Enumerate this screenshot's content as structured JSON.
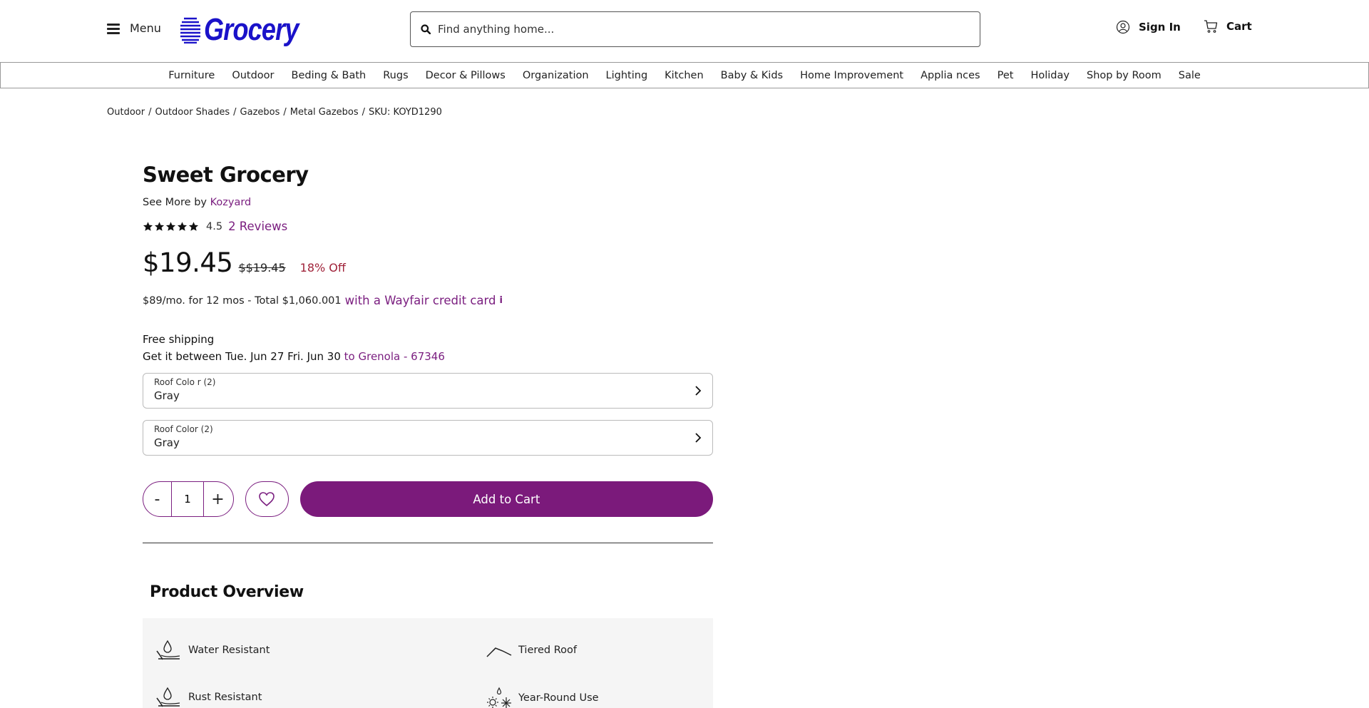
{
  "header": {
    "menu_label": "Menu",
    "logo_text": "Grocery",
    "search_placeholder": "Find anything home...",
    "signin_label": "Sign In",
    "cart_label": "Cart"
  },
  "nav": {
    "items": [
      "Furniture",
      "Outdoor",
      "Beding & Bath",
      "Rugs",
      "Decor & Pillows",
      "Organization",
      "Lighting",
      "Kitchen",
      "Baby & Kids",
      "Home Improvement",
      "Applia nces",
      "Pet",
      "Holiday",
      "Shop by Room",
      "Sale"
    ]
  },
  "breadcrumb": {
    "items": [
      "Outdoor",
      "Outdoor Shades",
      "Gazebos",
      "Metal Gazebos"
    ],
    "separator": "/",
    "sku": "SKU: KOYD1290"
  },
  "product": {
    "title": "Sweet Grocery",
    "see_more_prefix": "See More by",
    "brand": "Kozyard",
    "rating_value": "4.5",
    "rating_stars": 5,
    "reviews_label": "2 Reviews",
    "price": "$19.45",
    "old_price": "$$19.45",
    "discount": "18% Off",
    "finance_text": "$89/mo. for 12 mos - Total $1,060.001",
    "finance_link": "with a Wayfair credit card",
    "finance_info": "i",
    "shipping_title": "Free shipping",
    "delivery_text": "Get it between Tue. Jun 27 Fri. Jun 30",
    "delivery_link": "to Grenola - 67346",
    "options": [
      {
        "label": "Roof Colo r (2)",
        "value": "Gray"
      },
      {
        "label": "Roof Color (2)",
        "value": "Gray"
      }
    ],
    "quantity": "1",
    "minus_label": "-",
    "plus_label": "+",
    "add_to_cart_label": "Add to Cart"
  },
  "overview": {
    "title": "Product Overview",
    "features": [
      {
        "label": "Water Resistant",
        "icon": "water-drop-icon"
      },
      {
        "label": "Tiered Roof",
        "icon": "roof-icon"
      },
      {
        "label": "Rust Resistant",
        "icon": "water-drop-icon"
      },
      {
        "label": "Year-Round Use",
        "icon": "sun-snow-icon"
      }
    ]
  },
  "colors": {
    "accent": "#7b1a7b",
    "logo": "#1a12c9",
    "discount": "#a0233a"
  }
}
